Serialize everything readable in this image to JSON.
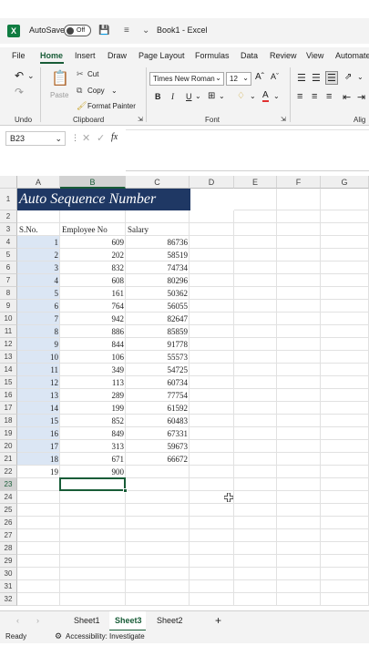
{
  "app": {
    "autosave_label": "AutoSave",
    "autosave_state": "Off",
    "doc_title": "Book1 - Excel",
    "accent": "#185c37",
    "title_bg": "#1f3864"
  },
  "tabs": [
    "File",
    "Home",
    "Insert",
    "Draw",
    "Page Layout",
    "Formulas",
    "Data",
    "Review",
    "View",
    "Automate"
  ],
  "ribbon": {
    "undo_group": "Undo",
    "clipboard_group": "Clipboard",
    "font_group": "Font",
    "align_group": "Alig",
    "paste": "Paste",
    "cut": "Cut",
    "copy": "Copy",
    "format_painter": "Format Painter",
    "font_name": "Times New Roman",
    "font_size": "12",
    "bold": "B",
    "italic": "I",
    "underline": "U"
  },
  "formula_bar": {
    "name_box": "B23",
    "fx": "fx",
    "formula": ""
  },
  "columns": [
    "A",
    "B",
    "C",
    "D",
    "E",
    "F",
    "G"
  ],
  "row_numbers": [
    "1",
    "2",
    "3",
    "4",
    "5",
    "6",
    "7",
    "8",
    "9",
    "10",
    "11",
    "12",
    "13",
    "14",
    "15",
    "16",
    "17",
    "18",
    "19",
    "20",
    "21",
    "22",
    "23",
    "24",
    "25",
    "26",
    "27",
    "28",
    "29",
    "30",
    "31",
    "32"
  ],
  "sheet": {
    "title": "Auto Sequence Number",
    "headers": [
      "S.No.",
      "Employee No",
      "Salary"
    ],
    "rows": [
      [
        "1",
        "609",
        "86736"
      ],
      [
        "2",
        "202",
        "58519"
      ],
      [
        "3",
        "832",
        "74734"
      ],
      [
        "4",
        "608",
        "80296"
      ],
      [
        "5",
        "161",
        "50362"
      ],
      [
        "6",
        "764",
        "56055"
      ],
      [
        "7",
        "942",
        "82647"
      ],
      [
        "8",
        "886",
        "85859"
      ],
      [
        "9",
        "844",
        "91778"
      ],
      [
        "10",
        "106",
        "55573"
      ],
      [
        "11",
        "349",
        "54725"
      ],
      [
        "12",
        "113",
        "60734"
      ],
      [
        "13",
        "289",
        "77754"
      ],
      [
        "14",
        "199",
        "61592"
      ],
      [
        "15",
        "852",
        "60483"
      ],
      [
        "16",
        "849",
        "67331"
      ],
      [
        "17",
        "313",
        "59673"
      ],
      [
        "18",
        "671",
        "66672"
      ],
      [
        "19",
        "900",
        ""
      ]
    ]
  },
  "sheet_tabs": [
    "Sheet1",
    "Sheet3",
    "Sheet2"
  ],
  "active_sheet": "Sheet3",
  "status": {
    "ready": "Ready",
    "accessibility": "Accessibility: Investigate"
  }
}
